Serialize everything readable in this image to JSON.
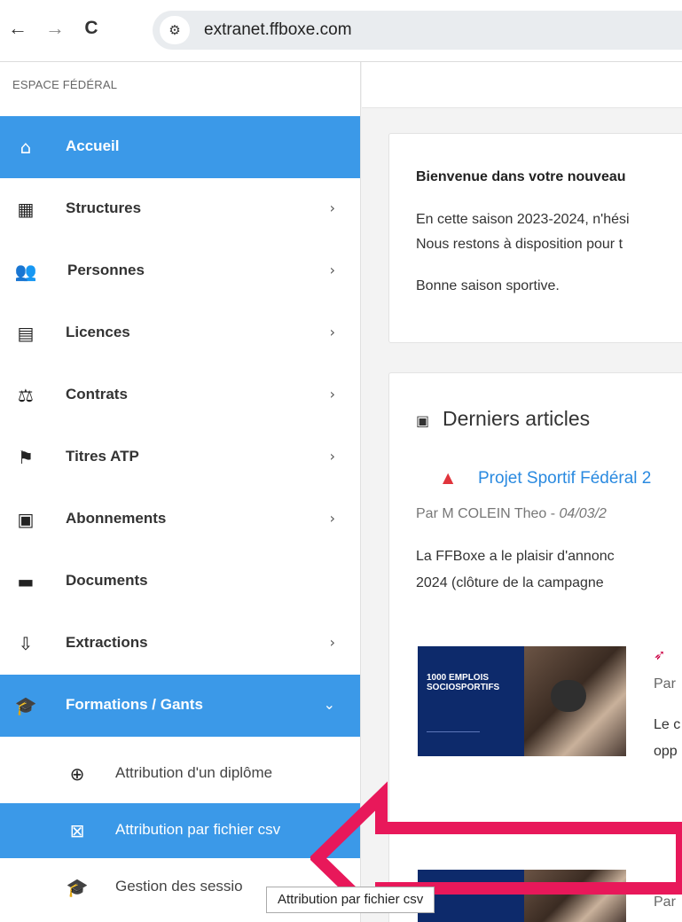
{
  "browser": {
    "url": "extranet.ffboxe.com"
  },
  "sidebar": {
    "header": "ESPACE FÉDÉRAL",
    "items": [
      {
        "label": "Accueil",
        "icon": "home-icon",
        "glyph": "⌂",
        "has_chevron": false,
        "active": true
      },
      {
        "label": "Structures",
        "icon": "buildings-icon",
        "glyph": "▦",
        "has_chevron": true
      },
      {
        "label": "Personnes",
        "icon": "people-icon",
        "glyph": "👥",
        "has_chevron": true
      },
      {
        "label": "Licences",
        "icon": "cards-icon",
        "glyph": "▤",
        "has_chevron": true
      },
      {
        "label": "Contrats",
        "icon": "handshake-icon",
        "glyph": "⚖",
        "has_chevron": true
      },
      {
        "label": "Titres ATP",
        "icon": "flag-icon",
        "glyph": "⚑",
        "has_chevron": true
      },
      {
        "label": "Abonnements",
        "icon": "newspaper-icon",
        "glyph": "▣",
        "has_chevron": true
      },
      {
        "label": "Documents",
        "icon": "folder-icon",
        "glyph": "▬",
        "has_chevron": false
      },
      {
        "label": "Extractions",
        "icon": "download-tray-icon",
        "glyph": "⇩",
        "has_chevron": true
      },
      {
        "label": "Formations / Gants",
        "icon": "graduation-cap-icon",
        "glyph": "🎓",
        "has_chevron": true,
        "expanded": true,
        "active": true
      }
    ],
    "sub_items": [
      {
        "label": "Attribution d'un diplôme",
        "icon": "plus-circle-icon",
        "glyph": "⊕"
      },
      {
        "label": "Attribution par fichier csv",
        "icon": "excel-file-icon",
        "glyph": "⊠",
        "active": true
      },
      {
        "label": "Gestion des sessio",
        "icon": "graduation-cap-icon",
        "glyph": "🎓"
      }
    ]
  },
  "welcome": {
    "title": "Bienvenue dans votre nouveau",
    "line1": "En cette saison 2023-2024, n'hési",
    "line2": "Nous restons à disposition pour t",
    "line3": "Bonne saison sportive."
  },
  "articles": {
    "heading": "Derniers articles",
    "first": {
      "title": "Projet Sportif Fédéral 2",
      "author_prefix": "Par M COLEIN Theo - ",
      "date": "04/03/2",
      "text1": "La FFBoxe a le plaisir d'annonc",
      "text2": "2024 (clôture de la campagne"
    },
    "second": {
      "thumb_title_1": "1000 EMPLOIS",
      "thumb_title_2": "SOCIOSPORTIFS",
      "meta": "Par",
      "text1": "Le c",
      "text2": "opp"
    },
    "third": {
      "meta": "Par"
    }
  },
  "tooltip": "Attribution par fichier csv",
  "colors": {
    "accent": "#3b99e8",
    "link": "#2a8ae0",
    "annotation": "#e8185a"
  }
}
